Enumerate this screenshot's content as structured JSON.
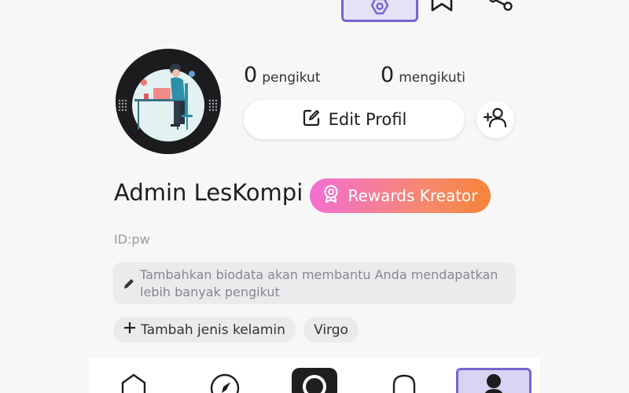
{
  "profile": {
    "followers_count": "0",
    "followers_label": "pengikut",
    "following_count": "0",
    "following_label": "mengikuti",
    "edit_label": "Edit Profil",
    "name": "Admin LesKompi",
    "rewards_label": "Rewards Kreator",
    "user_id": "ID:pw",
    "bio_placeholder": "Tambahkan biodata akan membantu Anda mendapatkan lebih banyak pengikut",
    "gender_chip": "Tambah jenis kelamin",
    "zodiac_chip": "Virgo"
  },
  "icons": {
    "topbar": [
      "settings-icon",
      "bookmark-icon",
      "share-icon"
    ],
    "edit": "edit-icon",
    "add_friend": "add-friend-icon",
    "rewards": "medal-icon",
    "bio": "pencil-icon",
    "chip": "plus-icon",
    "nav": [
      "home-icon",
      "explore-icon",
      "camera-icon",
      "notification-icon",
      "profile-icon"
    ]
  },
  "colors": {
    "accent": "#7566d0",
    "rewards_start": "#f36fd2",
    "rewards_end": "#f7833a",
    "background": "#f7f7f8"
  }
}
